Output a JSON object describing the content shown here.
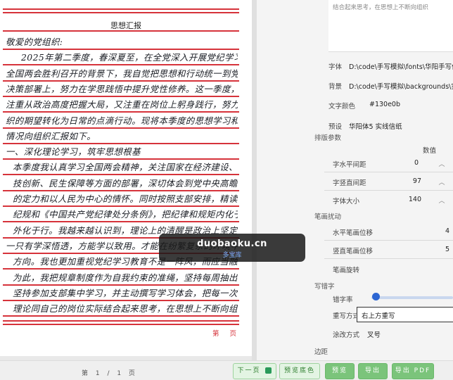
{
  "paper": {
    "title": "思想汇报",
    "lines": [
      "敬爱的党组织:",
      "2025年第二季度，春深夏至，在全党深入开展党纪学习教育、",
      "全国两会胜利召开的背景下，我自觉把思想和行动统一到党中央",
      "决策部署上，努力在学思践悟中提升党性修养。这一季度，我既",
      "注重从政治高度把握大局，又注重在岗位上躬身践行，努力把组",
      "织的期望转化为日常的点滴行动。现将本季度的思想学习和工作",
      "情况向组织汇报如下。",
      "一、深化理论学习，筑牢思想根基",
      "本季度我认真学习全国两会精神，关注国家在经济建设、科",
      "技创新、民生保障等方面的部署，深切体会到党中央高瞻远瞩",
      "的定力和以人民为中心的情怀。同时按照支部安排，精读学习党",
      "纪规和《中国共产党纪律处分条例》，把纪律和规矩内化于心、",
      "外化于行。我越来越认识到，理论上的清醒是政治上坚定的前提，",
      "一只有学深悟透，方能学以致用。才能在纷繁复杂的环境中不迷失",
      "方向。我也更加重视党纪学习教育不是一阵风，而应当融入日常。",
      "为此，我把规章制度作为自我约束的准绳，坚持每周抽出时间",
      "坚持参加支部集中学习，并主动撰写学习体会，把每一次学习",
      "理论同自己的岗位实际结合起来思考，在思想上不断向组织靠拢。"
    ],
    "page_label": "第 页"
  },
  "settings": {
    "hint_text": "结合起来思考，在思想上不断向组织",
    "font_label": "字体",
    "font_path": "D:\\code\\手写模拟\\fonts\\华阳手写体.ttf",
    "bg_label": "背景",
    "bg_path": "D:\\code\\手写模拟\\backgrounds\\实线信纸.png",
    "color_label": "文字颜色",
    "color_value": "#130e0b",
    "preset_label": "预设",
    "preset_value": "华阳体5 实线信纸",
    "layout_section": "排版参数",
    "value_header": "数值",
    "h_spacing_label": "字水平间距",
    "h_spacing_value": "0",
    "v_spacing_label": "字竖直间距",
    "v_spacing_value": "97",
    "font_size_label": "字体大小",
    "font_size_value": "140",
    "stroke_section": "笔画扰动",
    "h_offset_label": "水平笔画位移",
    "h_offset_value": "4",
    "v_offset_label": "竖直笔画位移",
    "v_offset_value": "5",
    "rotation_label": "笔画旋转",
    "typo_section": "写错字",
    "typo_rate_label": "错字率",
    "typo_rate_fraction": 0.05,
    "overwrite_label": "重写方式",
    "overwrite_value": "右上方重写",
    "strike_label": "涂改方式",
    "strike_value": "叉号",
    "margin_section": "边距"
  },
  "bottom": {
    "pager": "第 1 / 1 页",
    "next_label": "下一页",
    "preview_bg_label": "预览底色",
    "preview_label": "预览",
    "export_label": "导出",
    "export_pdf_label": "导出 PDF"
  },
  "watermark": {
    "main": "duobaoku.cn",
    "sub": "多宝库"
  },
  "colors": {
    "rule_red": "#d6333b",
    "ink": "#130e0b",
    "accent_blue": "#2c66d3",
    "button_green": "#7bc47b"
  }
}
